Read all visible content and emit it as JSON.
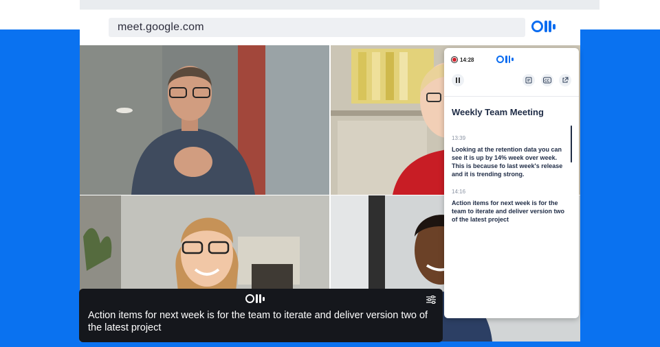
{
  "browser": {
    "url": "meet.google.com"
  },
  "colors": {
    "brand_blue": "#0a72f0",
    "recording_red": "#d1242f",
    "caption_bg": "#15171c",
    "heading_text": "#1e2b45"
  },
  "icons": {
    "brand_logo": "otter-logo",
    "record": "record-icon",
    "pause": "pause-icon",
    "notes": "notes-icon",
    "captions": "captions-icon",
    "popout": "external-link-icon",
    "settings": "settings-sliders-icon"
  },
  "panel": {
    "recording_time": "14:28",
    "meeting_title": "Weekly Team Meeting",
    "segments": [
      {
        "time": "13:39",
        "text": "Looking at the retention data you can see it is up by 14% week over week. This is because fo last week's release and it is trending strong."
      },
      {
        "time": "14:16",
        "text": "Action items for next week is for the team to iterate and deliver version two of the latest project"
      }
    ]
  },
  "caption": {
    "text": "Action items for next week is for the team to iterate and deliver version two of the latest project"
  }
}
